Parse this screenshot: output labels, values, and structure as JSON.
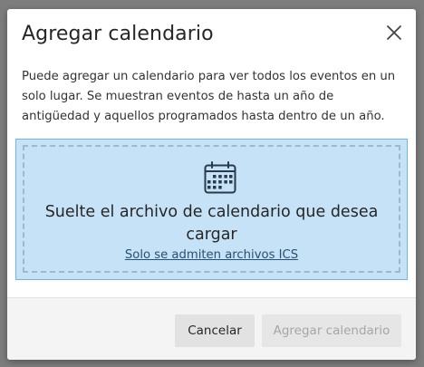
{
  "dialog": {
    "title": "Agregar calendario",
    "close_icon": "close-icon",
    "description": "Puede agregar un calendario para ver todos los eventos en un solo lugar. Se muestran eventos de hasta un año de antigüedad y aquellos programados hasta dentro de un año.",
    "dropzone": {
      "icon": "calendar-icon",
      "title": "Suelte el archivo de calendario que desea cargar",
      "link": "Solo se admiten archivos ICS"
    },
    "buttons": {
      "cancel": "Cancelar",
      "add": "Agregar calendario"
    }
  },
  "colors": {
    "dropzone_background": "#c5e2f6",
    "dropzone_border": "#6cb6e6",
    "link": "#2b4f73",
    "disabled_text": "#a6a6a6"
  }
}
